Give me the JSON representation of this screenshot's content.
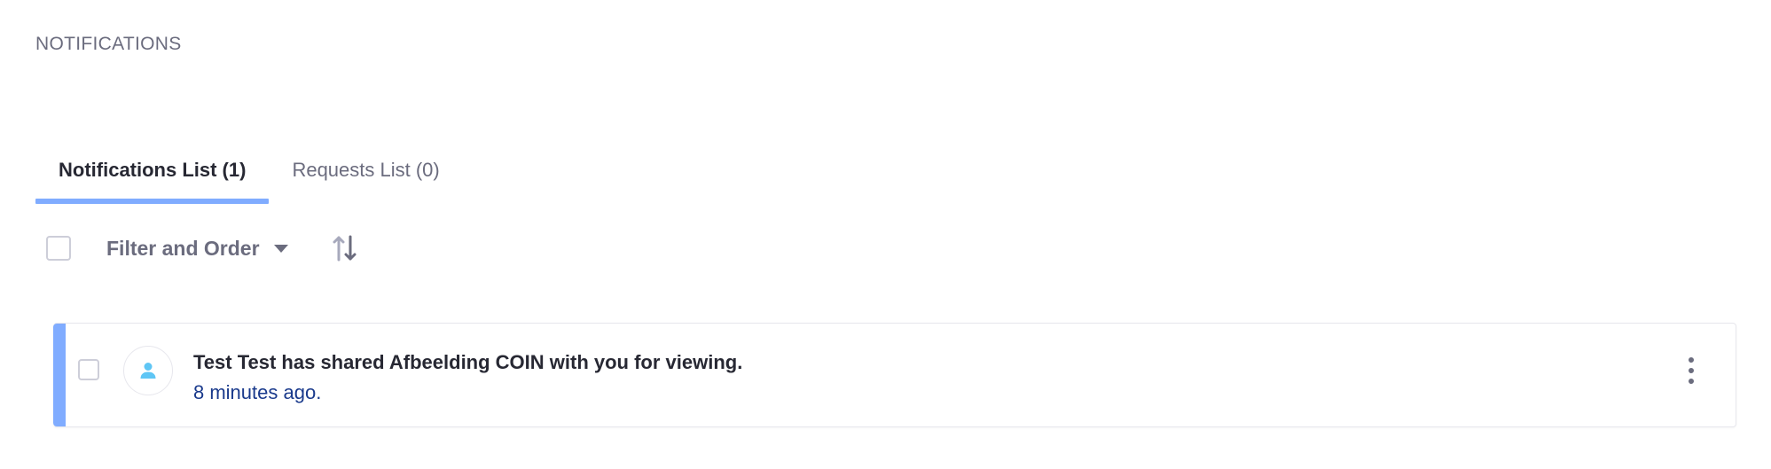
{
  "page": {
    "title": "NOTIFICATIONS"
  },
  "tabs": [
    {
      "label": "Notifications List (1)",
      "active": true
    },
    {
      "label": "Requests List (0)",
      "active": false
    }
  ],
  "toolbar": {
    "filter_label": "Filter and Order",
    "filter_icon": "caret-down-icon",
    "sort_icon": "sort-order-icon",
    "select_all_checked": false
  },
  "notifications": [
    {
      "message": "Test Test has shared Afbeelding COIN with you for viewing.",
      "time": "8 minutes ago.",
      "avatar_icon": "user-icon",
      "unread": true,
      "checked": false
    }
  ],
  "colors": {
    "accent": "#80acff",
    "link": "#1a3a8c",
    "muted_text": "#6b6c7e",
    "avatar_icon": "#5fc6f5"
  }
}
